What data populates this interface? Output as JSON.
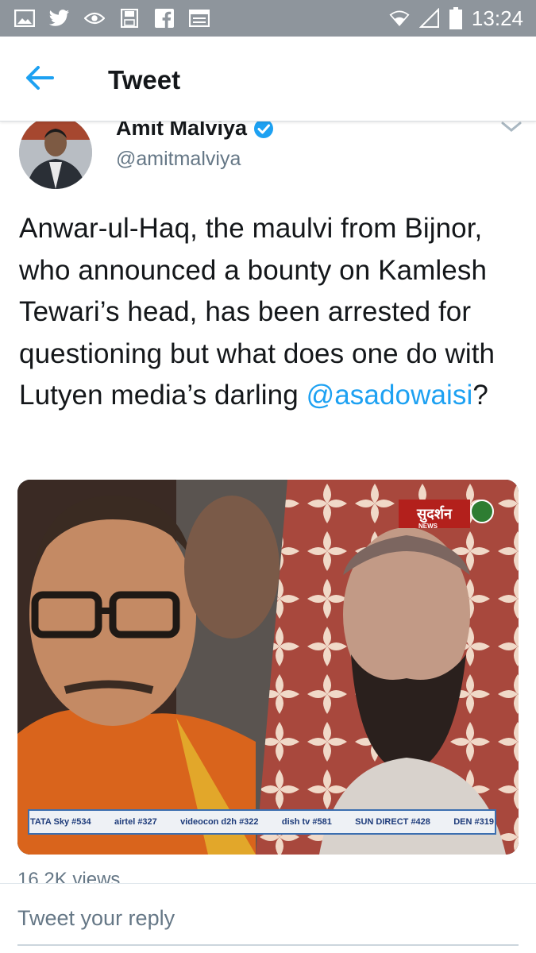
{
  "status_bar": {
    "time": "13:24",
    "icons": [
      "image-icon",
      "twitter-bird-icon",
      "eye-icon",
      "save-icon",
      "facebook-icon",
      "news-icon",
      "wifi-icon",
      "signal-icon",
      "battery-icon"
    ]
  },
  "app_bar": {
    "title": "Tweet",
    "back_icon": "arrow-left-icon"
  },
  "tweet": {
    "author_name": "Amit Malviya",
    "author_handle": "@amitmalviya",
    "verified": true,
    "text_part1": "Anwar-ul-Haq, the maulvi from Bijnor, who announced a bounty on Kamlesh Tewari’s head, has been arrested for questioning but what does one do with Lutyen media’s darling ",
    "mention": "@asadowaisi",
    "text_part2": "?",
    "views": "16.2K views",
    "media": {
      "channel_logo": "सुदर्शन",
      "channel_sub": "NEWS",
      "ticker": [
        {
          "provider": "TATA Sky",
          "channel_no": "#534"
        },
        {
          "provider": "airtel",
          "channel_no": "#327"
        },
        {
          "provider": "videocon d2h",
          "channel_no": "#322"
        },
        {
          "provider": "dish tv",
          "channel_no": "#581"
        },
        {
          "provider": "SUN DIRECT",
          "channel_no": "#428"
        },
        {
          "provider": "DEN",
          "channel_no": "#319"
        }
      ]
    }
  },
  "reply": {
    "placeholder": "Tweet your reply"
  },
  "colors": {
    "accent": "#1da1f2",
    "status_bar": "#8e959c",
    "text": "#14171a",
    "secondary_text": "#657786"
  }
}
